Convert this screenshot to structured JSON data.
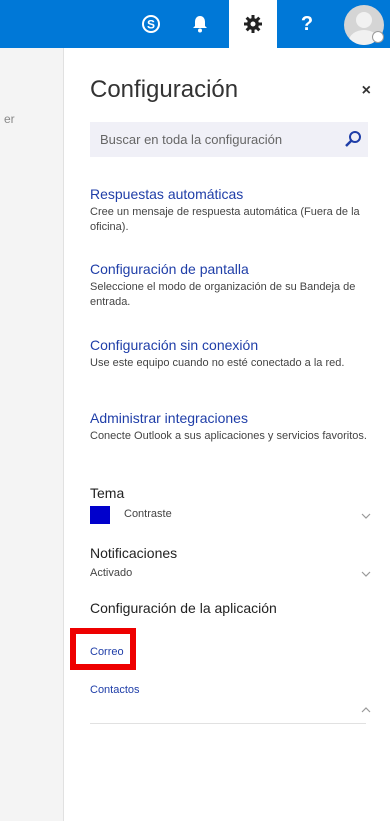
{
  "topbar": {
    "icons": [
      "skype-icon",
      "bell-icon",
      "gear-icon",
      "help-icon",
      "avatar"
    ],
    "help_label": "?"
  },
  "leftstrip": {
    "partial_text": "er"
  },
  "panel": {
    "title": "Configuración",
    "close": "×",
    "search_placeholder": "Buscar en toda la configuración",
    "sections": [
      {
        "link": "Respuestas automáticas",
        "desc": "Cree un mensaje de respuesta automática (Fuera de la oficina)."
      },
      {
        "link": "Configuración de pantalla",
        "desc": "Seleccione el modo de organización de su Bandeja de entrada."
      },
      {
        "link": "Configuración sin conexión",
        "desc": "Use este equipo cuando no esté conectado a la red."
      },
      {
        "link": "Administrar integraciones",
        "desc": "Conecte Outlook a sus aplicaciones y servicios favoritos."
      }
    ],
    "theme": {
      "title": "Tema",
      "value": "Contraste",
      "color": "#0000cc"
    },
    "notifications": {
      "title": "Notificaciones",
      "value": "Activado"
    },
    "app_settings": {
      "title": "Configuración de la aplicación",
      "links": [
        "Correo",
        "Contactos"
      ]
    }
  },
  "colors": {
    "topbar": "#0078d7",
    "link": "#1f3ea8",
    "highlight": "#ee0000"
  }
}
